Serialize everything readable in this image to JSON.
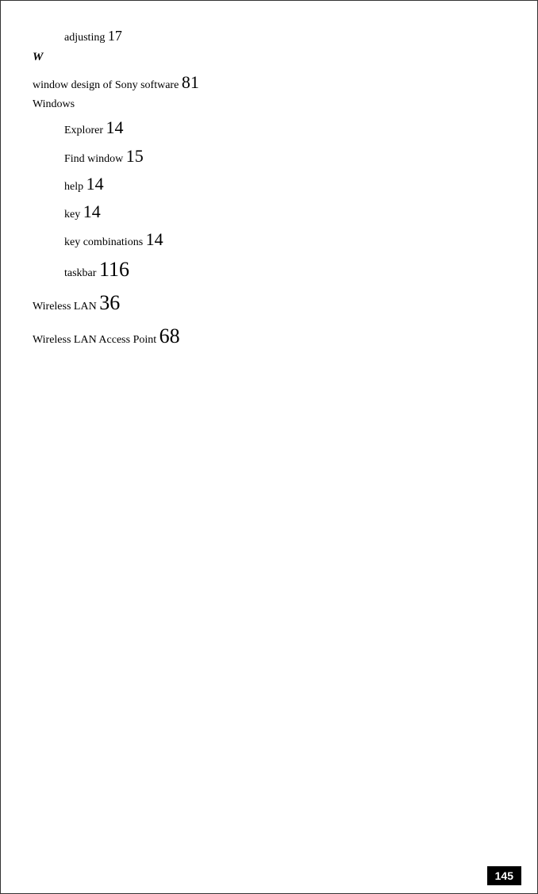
{
  "page": {
    "page_number": "145",
    "content": {
      "entries": [
        {
          "level": "level2",
          "text": "adjusting",
          "page": "17",
          "page_size": "medium"
        },
        {
          "level": "section",
          "letter": "W"
        },
        {
          "level": "level1",
          "text": "window design of Sony software",
          "page": "81",
          "page_size": "large"
        },
        {
          "level": "level1",
          "text": "Windows",
          "page": "",
          "page_size": "medium"
        },
        {
          "level": "level2",
          "text": "Explorer",
          "page": "14",
          "page_size": "large"
        },
        {
          "level": "level2",
          "text": "Find window",
          "page": "15",
          "page_size": "large"
        },
        {
          "level": "level2",
          "text": "help",
          "page": "14",
          "page_size": "large"
        },
        {
          "level": "level2",
          "text": "key",
          "page": "14",
          "page_size": "large"
        },
        {
          "level": "level2",
          "text": "key combinations",
          "page": "14",
          "page_size": "large"
        },
        {
          "level": "level2",
          "text": "taskbar",
          "page": "116",
          "page_size": "xlarge"
        },
        {
          "level": "level1",
          "text": "Wireless LAN",
          "page": "36",
          "page_size": "xlarge"
        },
        {
          "level": "level1",
          "text": "Wireless LAN Access Point",
          "page": "68",
          "page_size": "xlarge"
        }
      ]
    }
  }
}
